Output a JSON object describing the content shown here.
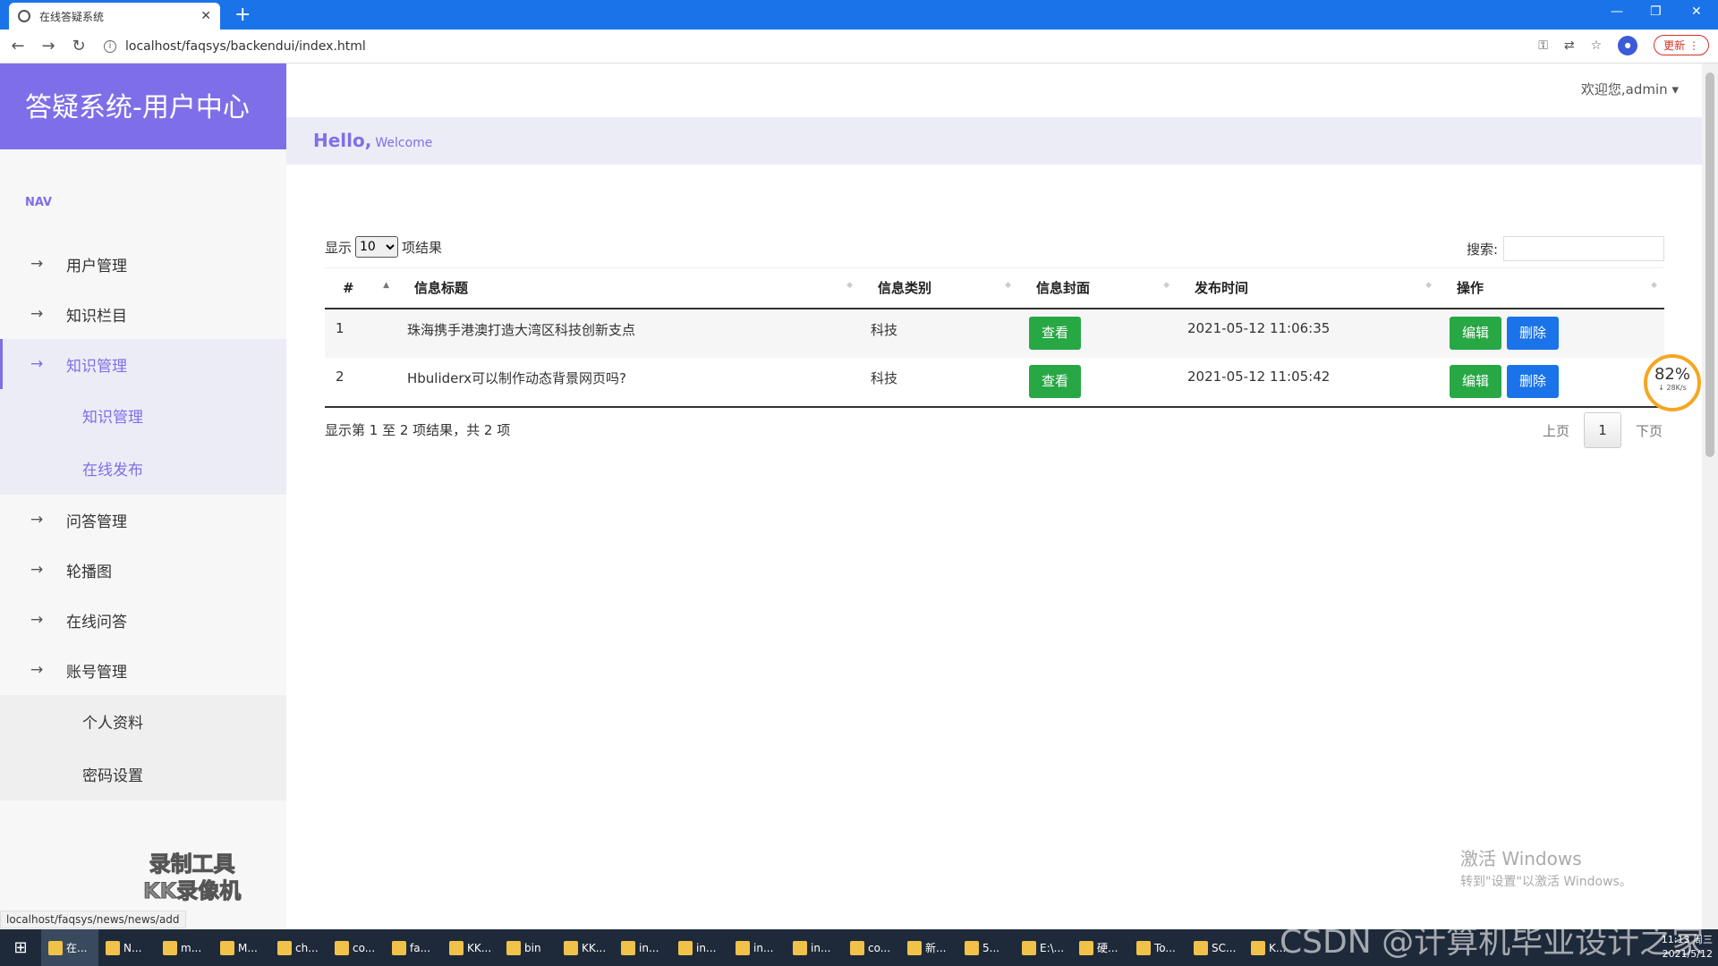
{
  "browser": {
    "tab_title": "在线答疑系统",
    "address": "localhost/faqsys/backendui/index.html",
    "update_label": "更新",
    "status_url": "localhost/faqsys/news/news/add"
  },
  "sidebar": {
    "brand": "答疑系统-用户中心",
    "nav_label": "NAV",
    "items": [
      {
        "label": "用户管理"
      },
      {
        "label": "知识栏目"
      },
      {
        "label": "知识管理"
      },
      {
        "label": "问答管理"
      },
      {
        "label": "轮播图"
      },
      {
        "label": "在线问答"
      },
      {
        "label": "账号管理"
      }
    ],
    "knowledge_sub": [
      "知识管理",
      "在线发布"
    ],
    "account_sub": [
      "个人资料",
      "密码设置"
    ],
    "rec_watermark_1": "录制工具",
    "rec_watermark_2": "KK录像机"
  },
  "header": {
    "welcome_user": "欢迎您,admin",
    "hello": "Hello,",
    "welcome": "Welcome"
  },
  "table": {
    "show_prefix": "显示",
    "page_size": "10",
    "show_suffix": "项结果",
    "search_label": "搜索:",
    "columns": [
      "#",
      "信息标题",
      "信息类别",
      "信息封面",
      "发布时间",
      "操作"
    ],
    "rows": [
      {
        "no": "1",
        "title": "珠海携手港澳打造大湾区科技创新支点",
        "category": "科技",
        "view": "查看",
        "time": "2021-05-12 11:06:35",
        "edit": "编辑",
        "delete": "删除"
      },
      {
        "no": "2",
        "title": "Hbuliderx可以制作动态背景网页吗?",
        "category": "科技",
        "view": "查看",
        "time": "2021-05-12 11:05:42",
        "edit": "编辑",
        "delete": "删除"
      }
    ],
    "info": "显示第 1 至 2 项结果，共 2 项",
    "prev": "上页",
    "current_page": "1",
    "next": "下页"
  },
  "overlay": {
    "speed_pct": "82%",
    "speed_rate": "↓ 28K/s",
    "activate_title": "激活 Windows",
    "activate_sub": "转到\"设置\"以激活 Windows。"
  },
  "taskbar": {
    "items": [
      "在...",
      "N...",
      "m...",
      "M...",
      "ch...",
      "co...",
      "fa...",
      "KK...",
      "bin",
      "KK...",
      "in...",
      "in...",
      "in...",
      "in...",
      "co...",
      "新...",
      "5...",
      "E:\\...",
      "硬...",
      "To...",
      "SC...",
      "K..."
    ],
    "time": "11:13 周三",
    "date": "2021/5/12",
    "watermark": "CSDN @计算机毕业设计之家"
  },
  "colors": {
    "accent": "#7e6fe8",
    "green": "#28a745",
    "blue": "#1a73e8"
  }
}
